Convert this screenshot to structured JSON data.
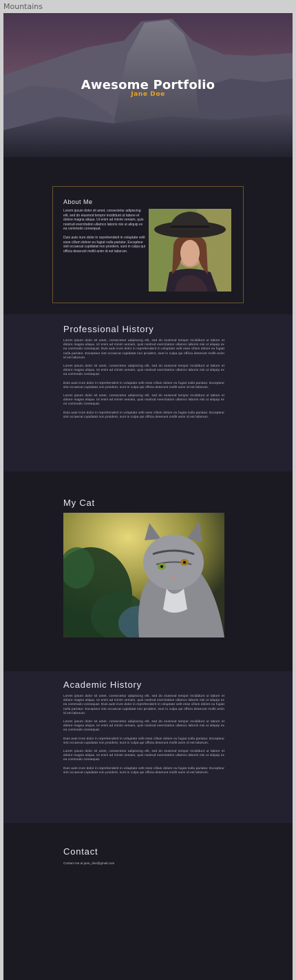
{
  "window": {
    "title": "Mountains"
  },
  "hero": {
    "title": "Awesome Portfolio",
    "subtitle": "Jane Doe"
  },
  "about": {
    "heading": "About Me",
    "paragraphs": [
      "Lorem ipsum dolor sit amet, consectetur adipiscing elit, sed do eiusmod tempor incididunt ut labore et dolore magna aliqua. Ut enim ad minim veniam, quis nostrud exercitation ullamco laboris nisi ut aliquip ex ea commodo consequat.",
      "Duis aute irure dolor in reprehenderit in voluptate velit esse cillum dolore eu fugiat nulla pariatur. Excepteur sint occaecat cupidatat non proident, sunt in culpa qui officia deserunt mollit anim id est laborum."
    ]
  },
  "professional": {
    "heading": "Professional History",
    "paragraphs": [
      "Lorem ipsum dolor sit amet, consectetur adipiscing elit, sed do eiusmod tempor incididunt ut labore et dolore magna aliqua. Ut enim ad minim veniam, quis nostrud exercitation ullamco laboris nisi ut aliquip ex ea commodo consequat. Duis aute irure dolor in reprehenderit in voluptate velit esse cillum dolore eu fugiat nulla pariatur. Excepteur sint occaecat cupidatat non proident, sunt in culpa qui officia deserunt mollit anim id est laborum.",
      "Lorem ipsum dolor sit amet, consectetur adipiscing elit, sed do eiusmod tempor incididunt ut labore et dolore magna aliqua. Ut enim ad minim veniam, quis nostrud exercitation ullamco laboris nisi ut aliquip ex ea commodo consequat.",
      "Duis aute irure dolor in reprehenderit in voluptate velit esse cillum dolore eu fugiat nulla pariatur. Excepteur sint occaecat cupidatat non proident, sunt in culpa qui officia deserunt mollit anim id est laborum.",
      "Lorem ipsum dolor sit amet, consectetur adipiscing elit, sed do eiusmod tempor incididunt ut labore et dolore magna aliqua. Ut enim ad minim veniam, quis nostrud exercitation ullamco laboris nisi ut aliquip ex ea commodo consequat.",
      "Duis aute irure dolor in reprehenderit in voluptate velit esse cillum dolore eu fugiat nulla pariatur. Excepteur sint occaecat cupidatat non proident, sunt in culpa qui officia deserunt mollit anim id est laborum."
    ]
  },
  "cat": {
    "heading": "My Cat"
  },
  "academic": {
    "heading": "Academic History",
    "paragraphs": [
      "Lorem ipsum dolor sit amet, consectetur adipiscing elit, sed do eiusmod tempor incididunt ut labore et dolore magna aliqua. Ut enim ad minim veniam, quis nostrud exercitation ullamco laboris nisi ut aliquip ex ea commodo consequat. Duis aute irure dolor in reprehenderit in voluptate velit esse cillum dolore eu fugiat nulla pariatur. Excepteur sint occaecat cupidatat non proident, sunt in culpa qui officia deserunt mollit anim id est laborum.",
      "Lorem ipsum dolor sit amet, consectetur adipiscing elit, sed do eiusmod tempor incididunt ut labore et dolore magna aliqua. Ut enim ad minim veniam, quis nostrud exercitation ullamco laboris nisi ut aliquip ex ea commodo consequat.",
      "Duis aute irure dolor in reprehenderit in voluptate velit esse cillum dolore eu fugiat nulla pariatur. Excepteur sint occaecat cupidatat non proident, sunt in culpa qui officia deserunt mollit anim id est laborum.",
      "Lorem ipsum dolor sit amet, consectetur adipiscing elit, sed do eiusmod tempor incididunt ut labore et dolore magna aliqua. Ut enim ad minim veniam, quis nostrud exercitation ullamco laboris nisi ut aliquip ex ea commodo consequat.",
      "Duis aute irure dolor in reprehenderit in voluptate velit esse cillum dolore eu fugiat nulla pariatur. Excepteur sint occaecat cupidatat non proident, sunt in culpa qui officia deserunt mollit anim id est laborum."
    ]
  },
  "contact": {
    "heading": "Contact",
    "line": "Contact me at jane_doe@gmail.com"
  },
  "colors": {
    "accent": "#e8a21f",
    "background": "#1b1a22",
    "section_alt": "#232130",
    "card_border": "#6b5530"
  }
}
